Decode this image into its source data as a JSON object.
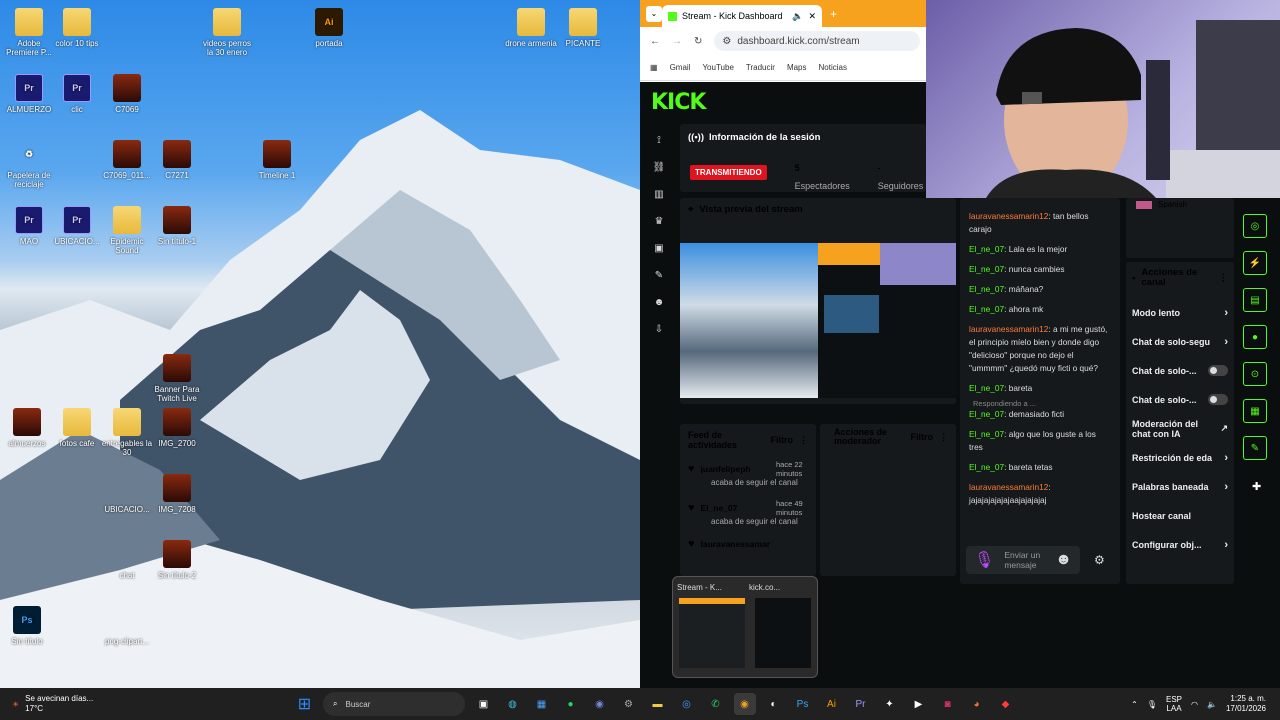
{
  "desktop": {
    "icons": [
      {
        "label": "Adobe Premiere P...",
        "glyph": "",
        "cls": "folder"
      },
      {
        "label": "color 10 tips",
        "glyph": "",
        "cls": "folder"
      },
      {
        "label": "videos perros la 30 enero",
        "glyph": "",
        "cls": "folder"
      },
      {
        "label": "portada",
        "glyph": "Ai",
        "cls": "ai"
      },
      {
        "label": "drone armenia",
        "glyph": "",
        "cls": "folder"
      },
      {
        "label": "PICANTE",
        "glyph": "",
        "cls": "folder"
      },
      {
        "label": "ALMUERZO",
        "glyph": "Pr",
        "cls": "pr"
      },
      {
        "label": "clic",
        "glyph": "Pr",
        "cls": "pr"
      },
      {
        "label": "C7069",
        "glyph": "",
        "cls": "img"
      },
      {
        "label": "Papelera de reciclaje",
        "glyph": "♻",
        "cls": ""
      },
      {
        "label": "C7069_011...",
        "glyph": "",
        "cls": "img"
      },
      {
        "label": "C7271",
        "glyph": "",
        "cls": "img"
      },
      {
        "label": "Timeline 1",
        "glyph": "",
        "cls": "img"
      },
      {
        "label": "MAO",
        "glyph": "Pr",
        "cls": "pr"
      },
      {
        "label": "UBICACIO...",
        "glyph": "Pr",
        "cls": "pr"
      },
      {
        "label": "Epidemic Sound",
        "glyph": "",
        "cls": "folder"
      },
      {
        "label": "Sin título-1",
        "glyph": "",
        "cls": "img"
      },
      {
        "label": "Banner Para Twitch Live",
        "glyph": "",
        "cls": "img"
      },
      {
        "label": "almuerzos",
        "glyph": "",
        "cls": "img"
      },
      {
        "label": "fotos cafe",
        "glyph": "",
        "cls": "folder"
      },
      {
        "label": "entregables la 30",
        "glyph": "",
        "cls": "folder"
      },
      {
        "label": "IMG_2700",
        "glyph": "",
        "cls": "img"
      },
      {
        "label": "UBICACIO...",
        "glyph": "",
        "cls": ""
      },
      {
        "label": "IMG_7208",
        "glyph": "",
        "cls": "img"
      },
      {
        "label": "chat",
        "glyph": "",
        "cls": ""
      },
      {
        "label": "Sin título-2",
        "glyph": "",
        "cls": "img"
      },
      {
        "label": "Sin título",
        "glyph": "Ps",
        "cls": "ps"
      },
      {
        "label": "png-clipart...",
        "glyph": "",
        "cls": ""
      }
    ]
  },
  "browser": {
    "tab_title": "Stream - Kick Dashboard",
    "url": "dashboard.kick.com/stream",
    "bookmarks": [
      "Gmail",
      "YouTube",
      "Traducir",
      "Maps",
      "Noticias"
    ]
  },
  "kick": {
    "logo": "KICK",
    "session_title": "Información de la sesión",
    "live_badge": "TRANSMITIENDO",
    "viewers_value": "5",
    "viewers_label": "Espectadores",
    "followers_value": "-",
    "followers_label": "Seguidores",
    "preview_title": "Vista previa del stream",
    "feed_title": "Feed de actividades",
    "feed_filter": "Filtro",
    "mod_title": "Acciones de moderador",
    "mod_filter": "Filtro",
    "feed": [
      {
        "user": "juanfelipeph",
        "time": "hace 22 minutos",
        "action": "acaba de seguir el canal"
      },
      {
        "user": "El_ne_07",
        "time": "hace 49 minutos",
        "action": "acaba de seguir el canal"
      },
      {
        "user": "lauravanessamarin12",
        "time": "",
        "action": ""
      }
    ],
    "chat": [
      {
        "user": "lauravanessamarin12",
        "text": "tan bellos carajo",
        "o": true
      },
      {
        "user": "El_ne_07",
        "text": "Lala es la mejor",
        "o": false
      },
      {
        "user": "El_ne_07",
        "text": "nunca cambies",
        "o": false
      },
      {
        "user": "El_ne_07",
        "text": "máñana?",
        "o": false
      },
      {
        "user": "El_ne_07",
        "text": "ahora mk",
        "o": false
      },
      {
        "user": "lauravanessamarin12",
        "text": "a mi me gustó, el principio míelo bien y donde digo \"delicioso\" porque no dejo el \"ummmm\" ¿quedó muy ficti o qué?",
        "o": true
      },
      {
        "user": "El_ne_07",
        "text": "bareta",
        "o": false
      },
      {
        "user": "El_ne_07",
        "text": "demasiado ficti",
        "o": false
      },
      {
        "user": "El_ne_07",
        "text": "algo que los guste a los tres",
        "o": false
      },
      {
        "user": "El_ne_07",
        "text": "bareta tetas",
        "o": false
      },
      {
        "user": "lauravanessamarin12",
        "text": "jajajajajajajaajajajajaj",
        "o": true
      }
    ],
    "replying": "Respondiendo a ...",
    "send_placeholder": "Enviar un mensaje",
    "language": "Spanish",
    "channel_actions_title": "Acciones de canal",
    "channel_actions": [
      {
        "label": "Modo lento",
        "ctrl": "arrow"
      },
      {
        "label": "Chat de solo-segu",
        "ctrl": "arrow"
      },
      {
        "label": "Chat de solo-...",
        "ctrl": "toggle"
      },
      {
        "label": "Chat de solo-...",
        "ctrl": "toggle"
      },
      {
        "label": "Moderación del chat con IA",
        "ctrl": "ext"
      },
      {
        "label": "Restricción de eda",
        "ctrl": "arrow"
      },
      {
        "label": "Palabras baneada",
        "ctrl": "arrow"
      },
      {
        "label": "Hostear canal",
        "ctrl": ""
      },
      {
        "label": "Configurar obj...",
        "ctrl": "arrow"
      }
    ]
  },
  "popup": {
    "tab1": "Stream - K...",
    "tab2": "kick.co..."
  },
  "taskbar": {
    "weather_temp": "17°C",
    "weather_text": "Se avecinan días...",
    "search": "Buscar",
    "lang": "ESP",
    "lang2": "LAA",
    "time": "1:25 a. m.",
    "date": "17/01/2026"
  }
}
